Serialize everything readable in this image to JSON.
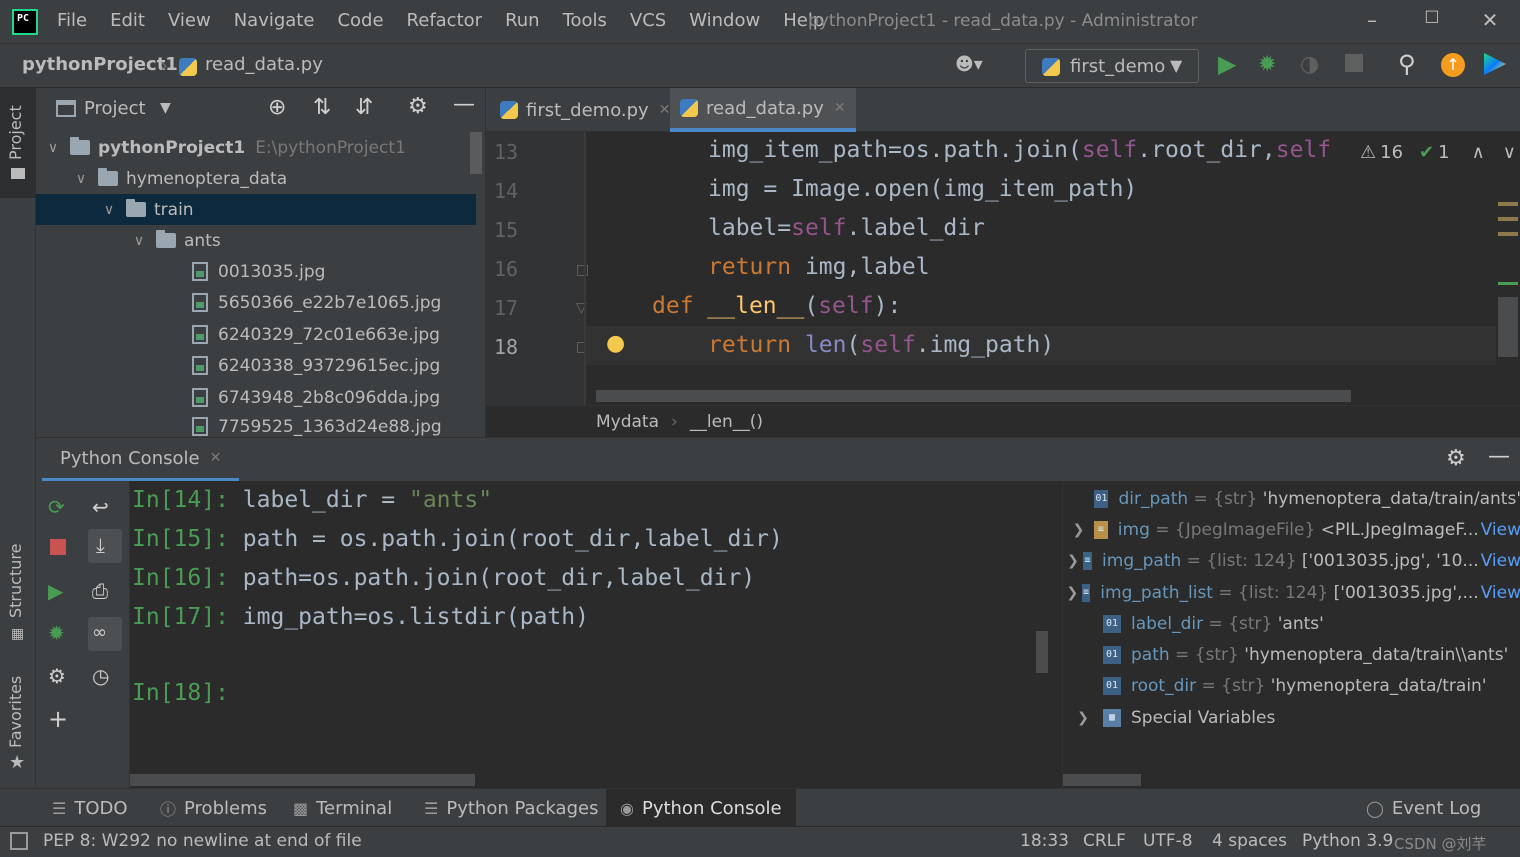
{
  "window": {
    "title": "pythonProject1 - read_data.py - Administrator",
    "logo_text": "PC"
  },
  "menu": [
    "File",
    "Edit",
    "View",
    "Navigate",
    "Code",
    "Refactor",
    "Run",
    "Tools",
    "VCS",
    "Window",
    "Help"
  ],
  "navbar": {
    "project": "pythonProject1",
    "file": "read_data.py",
    "run_config": "first_demo"
  },
  "left_strip": {
    "project_tab": "Project",
    "structure_tab": "Structure",
    "favorites_tab": "Favorites"
  },
  "project_panel": {
    "title": "Project",
    "tree": {
      "root": "pythonProject1",
      "root_path": "E:\\pythonProject1",
      "folder1": "hymenoptera_data",
      "folder2": "train",
      "folder3": "ants",
      "files": [
        "0013035.jpg",
        "5650366_e22b7e1065.jpg",
        "6240329_72c01e663e.jpg",
        "6240338_93729615ec.jpg",
        "6743948_2b8c096dda.jpg",
        "7759525_1363d24e88.jpg"
      ]
    }
  },
  "editor": {
    "tabs": [
      {
        "label": "first_demo.py"
      },
      {
        "label": "read_data.py"
      }
    ],
    "inspections": {
      "warnings": "16",
      "ok": "1"
    },
    "line_numbers": [
      "13",
      "14",
      "15",
      "16",
      "17",
      "18"
    ],
    "breadcrumb": [
      "Mydata",
      "__len__()"
    ]
  },
  "console": {
    "tab": "Python Console",
    "prompts": [
      "In[14]:",
      "In[15]:",
      "In[16]:",
      "In[17]:",
      "In[18]:"
    ],
    "lines": [
      "label_dir = ",
      "path = os.path.join(root_dir,label_dir)",
      "path=os.path.join(root_dir,label_dir)",
      "img_path=os.listdir(path)"
    ],
    "line14_string": "\"ants\""
  },
  "variables": [
    {
      "icon": "01",
      "name": "dir_path",
      "type": "{str}",
      "value": "'hymenoptera_data/train/ants'",
      "link": ""
    },
    {
      "icon": "img",
      "name": "img",
      "type": "{JpegImageFile}",
      "value": "<PIL.JpegImageF...",
      "link": "View"
    },
    {
      "icon": "list",
      "name": "img_path",
      "type": "{list: 124}",
      "value": "['0013035.jpg', '10...",
      "link": "View"
    },
    {
      "icon": "list",
      "name": "img_path_list",
      "type": "{list: 124}",
      "value": "['0013035.jpg',...",
      "link": "View"
    },
    {
      "icon": "01",
      "name": "label_dir",
      "type": "{str}",
      "value": "'ants'",
      "link": ""
    },
    {
      "icon": "01",
      "name": "path",
      "type": "{str}",
      "value": "'hymenoptera_data/train\\\\ants'",
      "link": ""
    },
    {
      "icon": "01",
      "name": "root_dir",
      "type": "{str}",
      "value": "'hymenoptera_data/train'",
      "link": ""
    }
  ],
  "special_variables": "Special Variables",
  "bottom_tabs": [
    "TODO",
    "Problems",
    "Terminal",
    "Python Packages",
    "Python Console",
    "Event Log"
  ],
  "status": {
    "message": "PEP 8: W292 no newline at end of file",
    "position": "18:33",
    "line_sep": "CRLF",
    "encoding": "UTF-8",
    "indent": "4 spaces",
    "interpreter": "Python 3.9",
    "watermark": "CSDN @刘芊"
  },
  "colors": {
    "accent": "#4a88c7",
    "run_green": "#499c54",
    "keyword": "#cc7832",
    "self": "#94558d"
  }
}
